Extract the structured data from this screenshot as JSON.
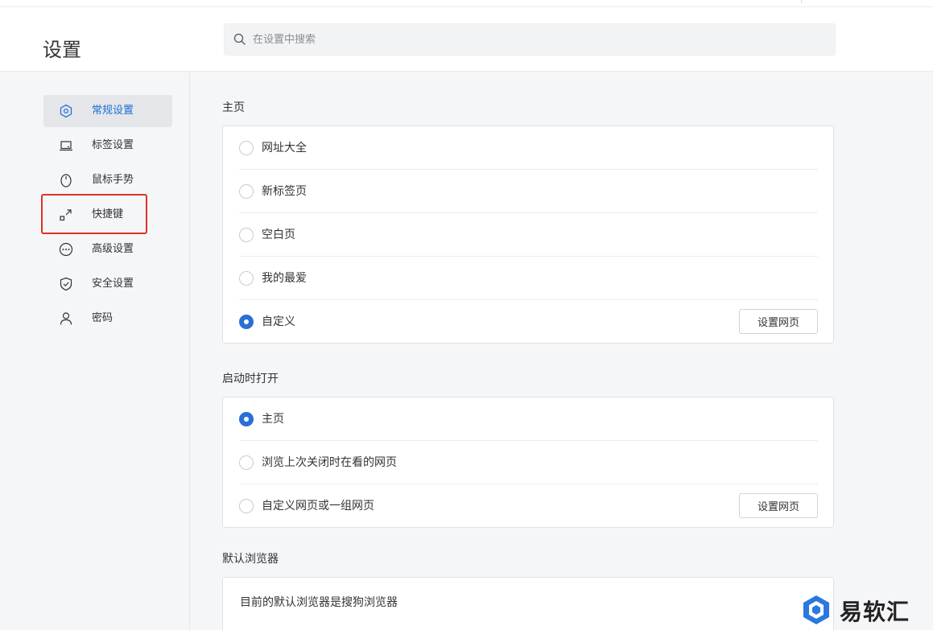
{
  "header": {
    "title": "设置",
    "search": {
      "placeholder": "在设置中搜索",
      "value": ""
    }
  },
  "sidebar": {
    "items": [
      {
        "label": "常规设置",
        "icon": "hexagon-settings-icon",
        "active": true
      },
      {
        "label": "标签设置",
        "icon": "laptop-tab-icon",
        "active": false
      },
      {
        "label": "鼠标手势",
        "icon": "mouse-icon",
        "active": false
      },
      {
        "label": "快捷键",
        "icon": "shortcut-arrow-icon",
        "active": false,
        "highlighted": true
      },
      {
        "label": "高级设置",
        "icon": "more-dots-icon",
        "active": false
      },
      {
        "label": "安全设置",
        "icon": "shield-check-icon",
        "active": false
      },
      {
        "label": "密码",
        "icon": "user-icon",
        "active": false
      }
    ]
  },
  "main": {
    "homepage": {
      "title": "主页",
      "options": [
        {
          "label": "网址大全",
          "checked": false
        },
        {
          "label": "新标签页",
          "checked": false
        },
        {
          "label": "空白页",
          "checked": false
        },
        {
          "label": "我的最爱",
          "checked": false
        },
        {
          "label": "自定义",
          "checked": true
        }
      ],
      "button_label": "设置网页"
    },
    "startup": {
      "title": "启动时打开",
      "options": [
        {
          "label": "主页",
          "checked": true
        },
        {
          "label": "浏览上次关闭时在看的网页",
          "checked": false
        },
        {
          "label": "自定义网页或一组网页",
          "checked": false
        }
      ],
      "button_label": "设置网页"
    },
    "default_browser": {
      "title": "默认浏览器",
      "text": "目前的默认浏览器是搜狗浏览器"
    }
  },
  "watermark": {
    "text": "易软汇"
  },
  "colors": {
    "accent": "#2a6fd6",
    "highlight": "#e0302a",
    "watermark": "#2a79e0"
  }
}
